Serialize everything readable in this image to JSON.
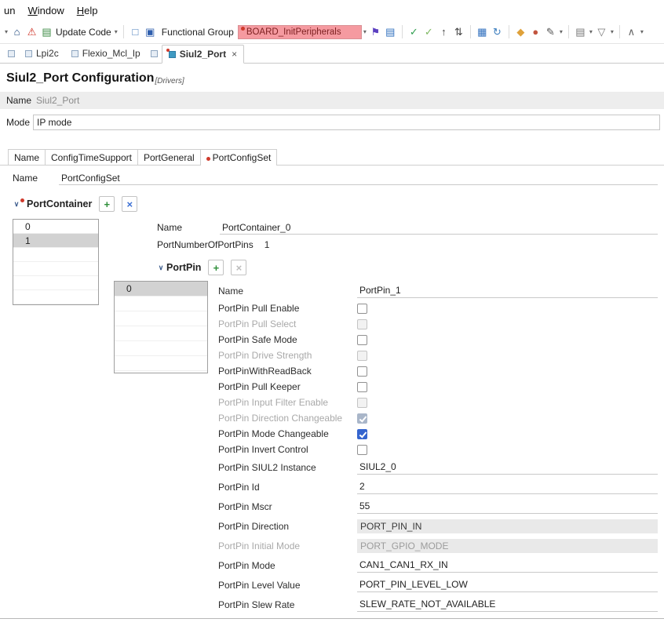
{
  "colors": {
    "checkbox_checked": "#3565cf",
    "marker_red": "#cf3a2c",
    "combo_bg": "#f59aa0",
    "combo_text": "#7c1f1f",
    "selection": "#d2d2d2"
  },
  "window": {
    "menu_items": [
      {
        "label": "un"
      },
      {
        "label": "Window",
        "mnemonic": 0
      },
      {
        "label": "Help",
        "mnemonic": 0
      }
    ]
  },
  "toolbar": {
    "items": [
      {
        "t": "caret",
        "glyph": "▾",
        "name": "dropdown-caret-icon"
      },
      {
        "t": "icon",
        "name": "home-icon",
        "glyph": "⌂",
        "color": "#17427a"
      },
      {
        "t": "icon",
        "name": "problems-icon",
        "glyph": "⚠",
        "color": "#cf2f23"
      },
      {
        "t": "icon",
        "name": "update-code-icon",
        "glyph": "▤",
        "color": "#3d8b44"
      },
      {
        "t": "button",
        "name": "update-code-button",
        "label": "Update Code"
      },
      {
        "t": "caret",
        "glyph": "▾",
        "name": "update-code-menu-icon"
      },
      {
        "t": "sep"
      },
      {
        "t": "icon",
        "name": "new-configuration-icon",
        "glyph": "□",
        "color": "#4a7dbb"
      },
      {
        "t": "icon",
        "name": "pins-tool-icon",
        "glyph": "▣",
        "color": "#2f5fae"
      },
      {
        "t": "label",
        "name": "functional-group-label",
        "text": "Functional Group"
      },
      {
        "t": "combo",
        "name": "functional-group-combo",
        "value": "BOARD_InitPeripherals",
        "marker": true
      },
      {
        "t": "caret",
        "glyph": "▾",
        "name": "functional-group-caret-icon"
      },
      {
        "t": "icon",
        "name": "flag-icon",
        "glyph": "⚑",
        "color": "#5b3fc0"
      },
      {
        "t": "icon",
        "name": "copy-registers-icon",
        "glyph": "▤",
        "color": "#2f6fbe"
      },
      {
        "t": "sep"
      },
      {
        "t": "icon",
        "name": "validate-icon",
        "glyph": "✓",
        "color": "#2f9e4f"
      },
      {
        "t": "icon",
        "name": "validate-all-icon",
        "glyph": "✓",
        "color": "#7fb862"
      },
      {
        "t": "icon",
        "name": "import-icon",
        "glyph": "↑",
        "color": "#444444"
      },
      {
        "t": "icon",
        "name": "sort-icon",
        "glyph": "⇅",
        "color": "#444444"
      },
      {
        "t": "sep"
      },
      {
        "t": "icon",
        "name": "registers-grid-icon",
        "glyph": "▦",
        "color": "#2f6fbe"
      },
      {
        "t": "icon",
        "name": "refresh-icon",
        "glyph": "↻",
        "color": "#3a7dbe"
      },
      {
        "t": "sep"
      },
      {
        "t": "icon",
        "name": "key-icon",
        "glyph": "◆",
        "color": "#dfa13a"
      },
      {
        "t": "icon",
        "name": "palette-icon",
        "glyph": "●",
        "color": "#c2553f"
      },
      {
        "t": "icon",
        "name": "pencil-icon",
        "glyph": "✎",
        "color": "#555555"
      },
      {
        "t": "caret",
        "glyph": "▾",
        "name": "pencil-menu-icon"
      },
      {
        "t": "sep"
      },
      {
        "t": "icon",
        "name": "layers-icon",
        "glyph": "▤",
        "color": "#777777"
      },
      {
        "t": "caret",
        "glyph": "▾",
        "name": "layers-menu-icon"
      },
      {
        "t": "icon",
        "name": "filter-icon",
        "glyph": "▽",
        "color": "#777777"
      },
      {
        "t": "caret",
        "glyph": "▾",
        "name": "filter-menu-icon"
      },
      {
        "t": "sep"
      },
      {
        "t": "icon",
        "name": "collapse-all-icon",
        "glyph": "∧",
        "color": "#666666"
      },
      {
        "t": "caret",
        "glyph": "▾",
        "name": "overflow-menu-icon"
      }
    ]
  },
  "editor_tabs": [
    {
      "type": "icon",
      "name": "restore-view-icon"
    },
    {
      "type": "tab",
      "label": "Lpi2c"
    },
    {
      "type": "tab",
      "label": "Flexio_Mcl_Ip"
    },
    {
      "type": "icon",
      "name": "restore-view-icon"
    },
    {
      "type": "tab",
      "label": "Siul2_Port",
      "active": true,
      "close": "×",
      "marker": true
    }
  ],
  "page": {
    "title": "Siul2_Port Configuration",
    "category": "[Drivers]",
    "name_label": "Name",
    "name_value": "Siul2_Port",
    "mode_label": "Mode",
    "mode_value": "IP mode"
  },
  "config_tabs": [
    {
      "label": "Name"
    },
    {
      "label": "ConfigTimeSupport"
    },
    {
      "label": "PortGeneral"
    },
    {
      "label": "PortConfigSet",
      "active": true,
      "marker": true
    }
  ],
  "config_form": {
    "name_label": "Name",
    "name_value": "PortConfigSet"
  },
  "port_container": {
    "twisty": "∨",
    "title": "PortContainer",
    "marker": true,
    "add": "+",
    "remove": "×",
    "list": {
      "rows": [
        "0",
        "1"
      ],
      "selected_index": 1,
      "empty_rows": 4
    },
    "name_label": "Name",
    "name_value": "PortContainer_0",
    "pins_label": "PortNumberOfPortPins",
    "pins_value": "1"
  },
  "port_pin": {
    "twisty": "∨",
    "title": "PortPin",
    "add": "+",
    "remove": "×",
    "remove_disabled": true,
    "list": {
      "rows": [
        "0"
      ],
      "selected_index": 0,
      "empty_rows": 5
    },
    "properties": [
      {
        "label": "Name",
        "type": "text",
        "value": "PortPin_1"
      },
      {
        "label": "PortPin Pull Enable",
        "type": "checkbox",
        "checked": false
      },
      {
        "label": "PortPin Pull Select",
        "type": "checkbox",
        "checked": false,
        "disabled": true
      },
      {
        "label": "PortPin Safe Mode",
        "type": "checkbox",
        "checked": false
      },
      {
        "label": "PortPin Drive Strength",
        "type": "checkbox",
        "checked": false,
        "disabled": true
      },
      {
        "label": "PortPinWithReadBack",
        "type": "checkbox",
        "checked": false
      },
      {
        "label": "PortPin Pull Keeper",
        "type": "checkbox",
        "checked": false
      },
      {
        "label": "PortPin Input Filter Enable",
        "type": "checkbox",
        "checked": false,
        "disabled": true
      },
      {
        "label": "PortPin Direction Changeable",
        "type": "checkbox",
        "checked": true,
        "disabled": true
      },
      {
        "label": "PortPin Mode Changeable",
        "type": "checkbox",
        "checked": true
      },
      {
        "label": "PortPin Invert Control",
        "type": "checkbox",
        "checked": false
      },
      {
        "label": "PortPin SIUL2 Instance",
        "type": "text",
        "value": "SIUL2_0"
      },
      {
        "label": "PortPin Id",
        "type": "text",
        "value": "2"
      },
      {
        "label": "PortPin Mscr",
        "type": "text",
        "value": "55"
      },
      {
        "label": "PortPin Direction",
        "type": "text",
        "value": "PORT_PIN_IN",
        "disabled": true
      },
      {
        "label": "PortPin Initial Mode",
        "type": "text",
        "value": "PORT_GPIO_MODE",
        "disabled": true,
        "muted": true
      },
      {
        "label": "PortPin Mode",
        "type": "text",
        "value": "CAN1_CAN1_RX_IN"
      },
      {
        "label": "PortPin Level Value",
        "type": "text",
        "value": "PORT_PIN_LEVEL_LOW"
      },
      {
        "label": "PortPin Slew Rate",
        "type": "text",
        "value": "SLEW_RATE_NOT_AVAILABLE"
      }
    ]
  }
}
